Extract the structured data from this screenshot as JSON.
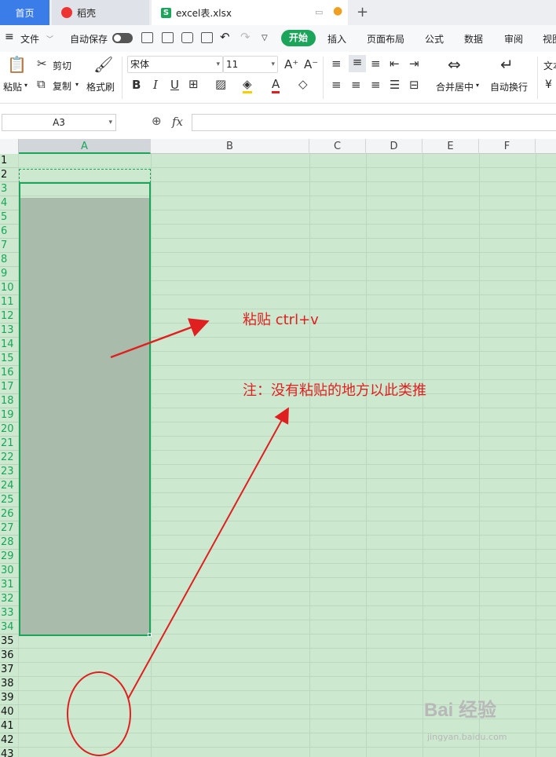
{
  "tabs": {
    "home": "首页",
    "daoke": "稻壳",
    "file": "excel表.xlsx"
  },
  "menu": {
    "file": "文件",
    "autosave": "自动保存",
    "items": [
      "开始",
      "插入",
      "页面布局",
      "公式",
      "数据",
      "审阅",
      "视图"
    ]
  },
  "ribbon": {
    "paste": "粘贴",
    "cut": "剪切",
    "copy": "复制",
    "format_painter": "格式刷",
    "font_name": "宋体",
    "font_size": "11",
    "merge_center": "合并居中",
    "wrap_text": "自动换行",
    "text_partial": "文本"
  },
  "formula_bar": {
    "name_box": "A3",
    "fx": "fx",
    "value": ""
  },
  "columns": [
    "A",
    "B",
    "C",
    "D",
    "E",
    "F"
  ],
  "rows": [
    "1",
    "2",
    "3",
    "4",
    "5",
    "6",
    "7",
    "8",
    "9",
    "10",
    "11",
    "12",
    "13",
    "14",
    "15",
    "16",
    "17",
    "18",
    "19",
    "20",
    "21",
    "22",
    "23",
    "24",
    "25",
    "26",
    "27",
    "28",
    "29",
    "30",
    "31",
    "32",
    "33",
    "34",
    "35",
    "36",
    "37",
    "38",
    "39",
    "40",
    "41",
    "42",
    "43"
  ],
  "selection": {
    "active_cell": "A3",
    "range": "A3:A34",
    "copy_marquee": "A2"
  },
  "annotations": {
    "paste_note": "粘贴 ctrl+v",
    "remark": "注：没有粘贴的地方以此类推",
    "color": "#e02020"
  },
  "watermark": {
    "logo": "Bai 经验",
    "url": "jingyan.baidu.com"
  },
  "colors": {
    "accent": "#1aa55a",
    "sheet_background": "#cce8cf",
    "selection_fill": "#a9bcab",
    "tab_active": "#3a7ce8"
  }
}
